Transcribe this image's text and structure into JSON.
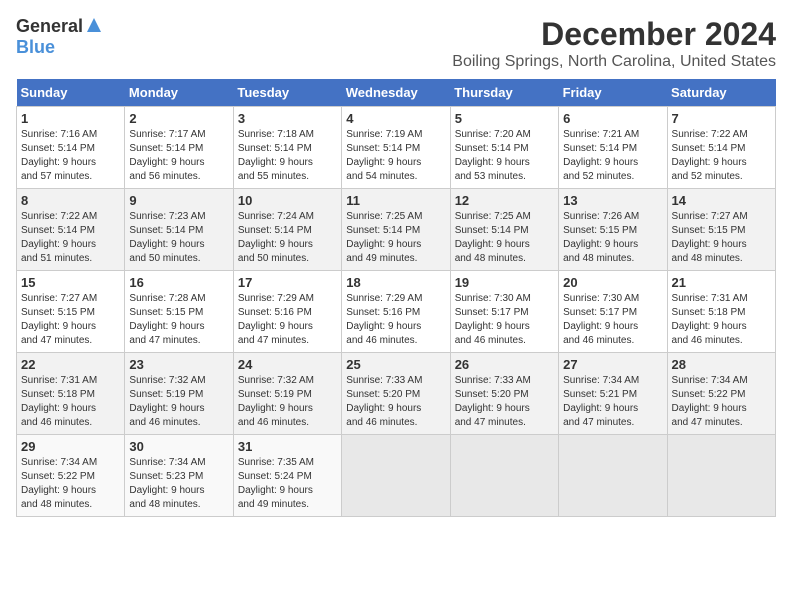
{
  "logo": {
    "general": "General",
    "blue": "Blue"
  },
  "title": {
    "month": "December 2024",
    "location": "Boiling Springs, North Carolina, United States"
  },
  "weekdays": [
    "Sunday",
    "Monday",
    "Tuesday",
    "Wednesday",
    "Thursday",
    "Friday",
    "Saturday"
  ],
  "weeks": [
    [
      {
        "day": "1",
        "info": "Sunrise: 7:16 AM\nSunset: 5:14 PM\nDaylight: 9 hours\nand 57 minutes."
      },
      {
        "day": "2",
        "info": "Sunrise: 7:17 AM\nSunset: 5:14 PM\nDaylight: 9 hours\nand 56 minutes."
      },
      {
        "day": "3",
        "info": "Sunrise: 7:18 AM\nSunset: 5:14 PM\nDaylight: 9 hours\nand 55 minutes."
      },
      {
        "day": "4",
        "info": "Sunrise: 7:19 AM\nSunset: 5:14 PM\nDaylight: 9 hours\nand 54 minutes."
      },
      {
        "day": "5",
        "info": "Sunrise: 7:20 AM\nSunset: 5:14 PM\nDaylight: 9 hours\nand 53 minutes."
      },
      {
        "day": "6",
        "info": "Sunrise: 7:21 AM\nSunset: 5:14 PM\nDaylight: 9 hours\nand 52 minutes."
      },
      {
        "day": "7",
        "info": "Sunrise: 7:22 AM\nSunset: 5:14 PM\nDaylight: 9 hours\nand 52 minutes."
      }
    ],
    [
      {
        "day": "8",
        "info": "Sunrise: 7:22 AM\nSunset: 5:14 PM\nDaylight: 9 hours\nand 51 minutes."
      },
      {
        "day": "9",
        "info": "Sunrise: 7:23 AM\nSunset: 5:14 PM\nDaylight: 9 hours\nand 50 minutes."
      },
      {
        "day": "10",
        "info": "Sunrise: 7:24 AM\nSunset: 5:14 PM\nDaylight: 9 hours\nand 50 minutes."
      },
      {
        "day": "11",
        "info": "Sunrise: 7:25 AM\nSunset: 5:14 PM\nDaylight: 9 hours\nand 49 minutes."
      },
      {
        "day": "12",
        "info": "Sunrise: 7:25 AM\nSunset: 5:14 PM\nDaylight: 9 hours\nand 48 minutes."
      },
      {
        "day": "13",
        "info": "Sunrise: 7:26 AM\nSunset: 5:15 PM\nDaylight: 9 hours\nand 48 minutes."
      },
      {
        "day": "14",
        "info": "Sunrise: 7:27 AM\nSunset: 5:15 PM\nDaylight: 9 hours\nand 48 minutes."
      }
    ],
    [
      {
        "day": "15",
        "info": "Sunrise: 7:27 AM\nSunset: 5:15 PM\nDaylight: 9 hours\nand 47 minutes."
      },
      {
        "day": "16",
        "info": "Sunrise: 7:28 AM\nSunset: 5:15 PM\nDaylight: 9 hours\nand 47 minutes."
      },
      {
        "day": "17",
        "info": "Sunrise: 7:29 AM\nSunset: 5:16 PM\nDaylight: 9 hours\nand 47 minutes."
      },
      {
        "day": "18",
        "info": "Sunrise: 7:29 AM\nSunset: 5:16 PM\nDaylight: 9 hours\nand 46 minutes."
      },
      {
        "day": "19",
        "info": "Sunrise: 7:30 AM\nSunset: 5:17 PM\nDaylight: 9 hours\nand 46 minutes."
      },
      {
        "day": "20",
        "info": "Sunrise: 7:30 AM\nSunset: 5:17 PM\nDaylight: 9 hours\nand 46 minutes."
      },
      {
        "day": "21",
        "info": "Sunrise: 7:31 AM\nSunset: 5:18 PM\nDaylight: 9 hours\nand 46 minutes."
      }
    ],
    [
      {
        "day": "22",
        "info": "Sunrise: 7:31 AM\nSunset: 5:18 PM\nDaylight: 9 hours\nand 46 minutes."
      },
      {
        "day": "23",
        "info": "Sunrise: 7:32 AM\nSunset: 5:19 PM\nDaylight: 9 hours\nand 46 minutes."
      },
      {
        "day": "24",
        "info": "Sunrise: 7:32 AM\nSunset: 5:19 PM\nDaylight: 9 hours\nand 46 minutes."
      },
      {
        "day": "25",
        "info": "Sunrise: 7:33 AM\nSunset: 5:20 PM\nDaylight: 9 hours\nand 46 minutes."
      },
      {
        "day": "26",
        "info": "Sunrise: 7:33 AM\nSunset: 5:20 PM\nDaylight: 9 hours\nand 47 minutes."
      },
      {
        "day": "27",
        "info": "Sunrise: 7:34 AM\nSunset: 5:21 PM\nDaylight: 9 hours\nand 47 minutes."
      },
      {
        "day": "28",
        "info": "Sunrise: 7:34 AM\nSunset: 5:22 PM\nDaylight: 9 hours\nand 47 minutes."
      }
    ],
    [
      {
        "day": "29",
        "info": "Sunrise: 7:34 AM\nSunset: 5:22 PM\nDaylight: 9 hours\nand 48 minutes."
      },
      {
        "day": "30",
        "info": "Sunrise: 7:34 AM\nSunset: 5:23 PM\nDaylight: 9 hours\nand 48 minutes."
      },
      {
        "day": "31",
        "info": "Sunrise: 7:35 AM\nSunset: 5:24 PM\nDaylight: 9 hours\nand 49 minutes."
      },
      {
        "day": "",
        "info": ""
      },
      {
        "day": "",
        "info": ""
      },
      {
        "day": "",
        "info": ""
      },
      {
        "day": "",
        "info": ""
      }
    ]
  ]
}
